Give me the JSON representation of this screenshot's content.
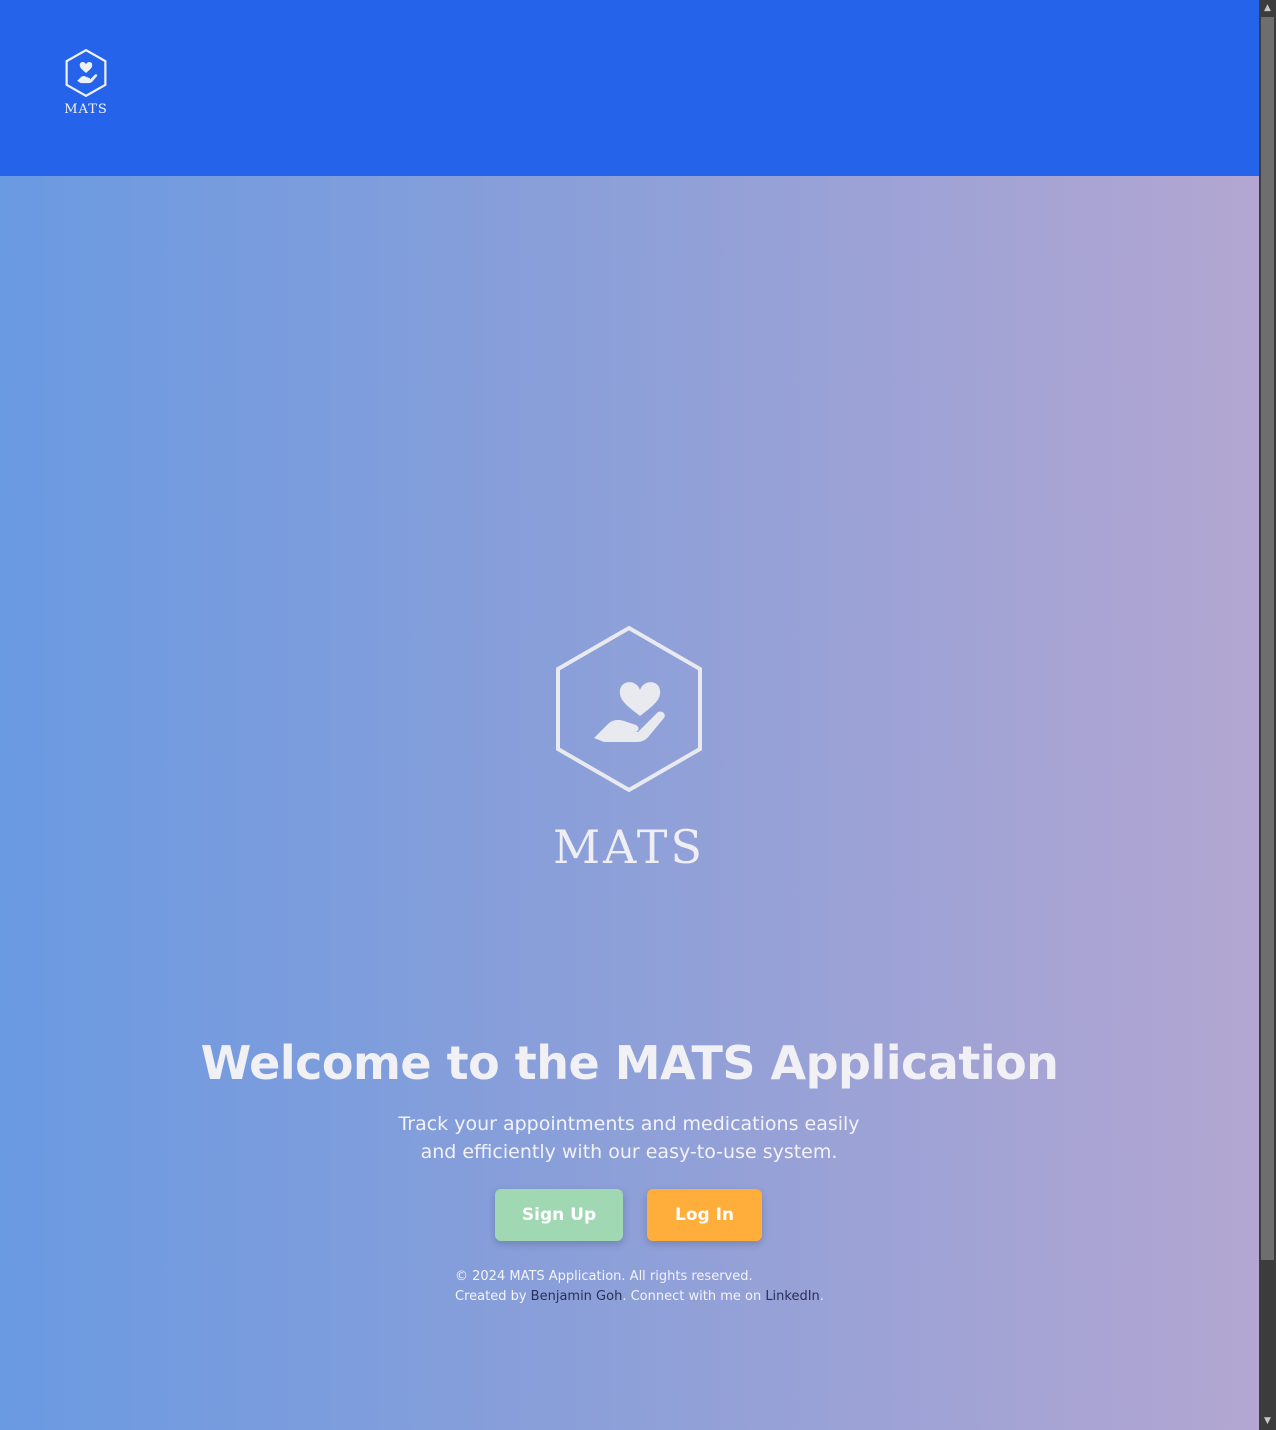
{
  "header": {
    "brand_name": "MATS",
    "background_color": "#2563eb",
    "logo_icon": "hexagon-hand-heart-icon"
  },
  "hero": {
    "logo_text": "MATS",
    "logo_icon": "hexagon-hand-heart-icon",
    "title": "Welcome to the MATS Application",
    "tagline": "Track your appointments and medications easily and efficiently with our easy-to-use system.",
    "gradient": [
      "#6a9ae2",
      "#8a9fd9",
      "#b3a6d2"
    ]
  },
  "actions": {
    "signup_label": "Sign Up",
    "signup_color": "#a0d8b3",
    "login_label": "Log In",
    "login_color": "#ffad3b"
  },
  "footer": {
    "copyright": "© 2024 MATS Application. All rights reserved.",
    "created_by_prefix": "Created by ",
    "author_name": "Benjamin Goh",
    "connect_text": ". Connect with me on ",
    "linkedin_label": "LinkedIn",
    "suffix": "."
  },
  "scrollbar": {
    "up_arrow": "▲",
    "down_arrow": "▼"
  }
}
